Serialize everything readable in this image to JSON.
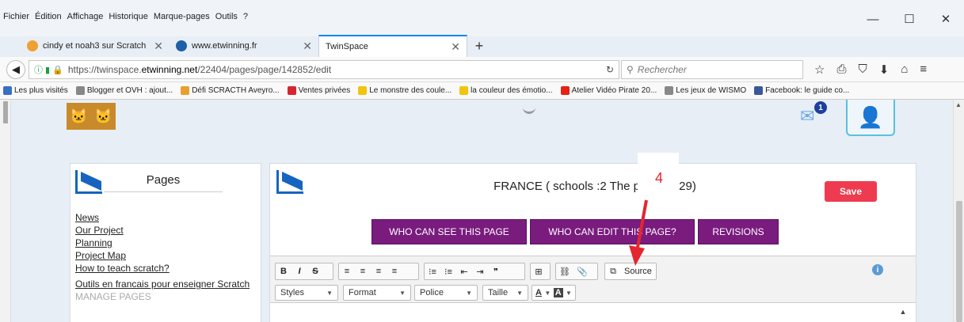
{
  "menu": [
    "Fichier",
    "Édition",
    "Affichage",
    "Historique",
    "Marque-pages",
    "Outils",
    "?"
  ],
  "window_controls": {
    "minimize": "—",
    "maximize": "☐",
    "close": "✕"
  },
  "tabs": [
    {
      "label": "cindy et noah3 sur Scratch",
      "color": "#f0a030",
      "close": "✕"
    },
    {
      "label": "www.etwinning.fr",
      "color": "#1e5fa8",
      "close": "✕"
    },
    {
      "label": "TwinSpace",
      "color": "#ffffff",
      "close": "✕"
    }
  ],
  "new_tab": "+",
  "navbar": {
    "url_prefix": "https://twinspace.",
    "url_domain": "etwinning.net",
    "url_path": "/22404/pages/page/142852/edit",
    "search_placeholder": "Rechercher",
    "icons": [
      "☆",
      "⎙",
      "⛉",
      "⬇",
      "⌂",
      "≡"
    ]
  },
  "bookmarks": [
    {
      "label": "Les plus visités",
      "color": "#3a6fc4"
    },
    {
      "label": "Blogger et OVH : ajout...",
      "color": "#888888"
    },
    {
      "label": "Défi SCRACTH Aveyro...",
      "color": "#e8a02c"
    },
    {
      "label": "Ventes privées",
      "color": "#d5252f"
    },
    {
      "label": "Le monstre des coule...",
      "color": "#f1c40f"
    },
    {
      "label": "la couleur des émotio...",
      "color": "#f1c40f"
    },
    {
      "label": "Atelier Vidéo Pirate 20...",
      "color": "#e62117"
    },
    {
      "label": "Les jeux de WISMO",
      "color": "#888888"
    },
    {
      "label": "Facebook: le guide co...",
      "color": "#3b5998"
    }
  ],
  "header": {
    "mail_badge": "1"
  },
  "pages_panel": {
    "title": "Pages",
    "links": [
      "News",
      "Our Project",
      "Planning",
      "Project Map",
      "How to teach scratch?",
      "Outils en francais pour enseigner Scratch"
    ],
    "faded_link": "MANAGE PAGES"
  },
  "editor": {
    "page_title": "FRANCE ( schools :2    The prese        s :29)",
    "annotation_number": "4",
    "save_label": "Save",
    "buttons": [
      "WHO CAN SEE THIS PAGE",
      "WHO CAN EDIT THIS PAGE?",
      "REVISIONS"
    ],
    "toolbar": {
      "format_buttons": [
        "B",
        "I",
        "S"
      ],
      "align_buttons": [
        "≡",
        "≡",
        "≡",
        "≡"
      ],
      "list_buttons": [
        "⁝≡",
        "⁝≡",
        "⇤",
        "⇥",
        "❞"
      ],
      "table_icon": "⊞",
      "link_icon": "⛓",
      "attach_icon": "📎",
      "source_label": "Source",
      "styles": "Styles",
      "format": "Format",
      "font": "Police",
      "size": "Taille",
      "text_color": "A",
      "bg_color": "A"
    },
    "info_icon": "i"
  },
  "colors": {
    "accent": "#0a84ff",
    "purple": "#7a1b7e",
    "save": "#ee3b4f",
    "arrow": "#e3262f"
  }
}
